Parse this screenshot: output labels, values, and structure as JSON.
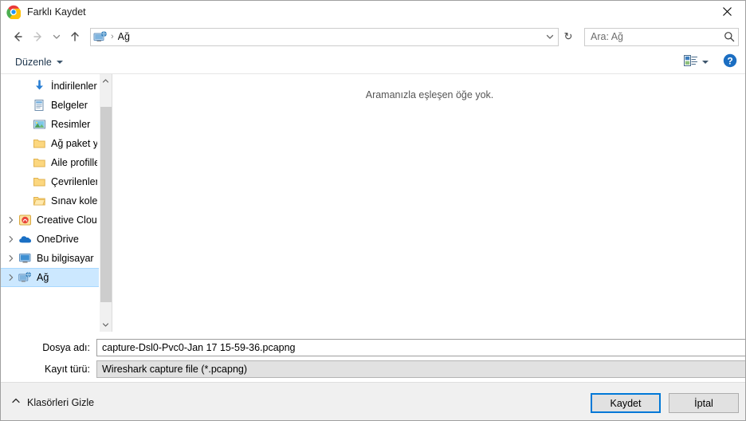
{
  "window": {
    "title": "Farklı Kaydet",
    "app_icon": "chrome-icon",
    "close_label": "×"
  },
  "nav": {
    "back_icon": "back-arrow-icon",
    "forward_icon": "forward-arrow-icon",
    "recent_icon": "chevron-down-icon",
    "up_icon": "up-arrow-icon",
    "address_icon": "network-icon",
    "breadcrumb": "Ağ",
    "breadcrumb_separator": "›",
    "dropdown_icon": "chevron-down-icon",
    "refresh_icon": "refresh-icon",
    "refresh_glyph": "↻"
  },
  "search": {
    "placeholder": "Ara: Ağ",
    "icon": "search-icon"
  },
  "toolbar": {
    "organize_label": "Düzenle",
    "organize_icon": "caret-down-icon",
    "view_icon": "view-layout-icon",
    "view_dropdown_icon": "caret-down-icon",
    "help_icon": "help-circle-icon"
  },
  "sidebar": {
    "items": [
      {
        "label": "İndirilenler",
        "icon": "downloads-icon",
        "pinned": true,
        "expander": false,
        "indent": true,
        "selected": false
      },
      {
        "label": "Belgeler",
        "icon": "documents-icon",
        "pinned": true,
        "expander": false,
        "indent": true,
        "selected": false
      },
      {
        "label": "Resimler",
        "icon": "pictures-icon",
        "pinned": true,
        "expander": false,
        "indent": true,
        "selected": false
      },
      {
        "label": "Ağ paket yakalar",
        "icon": "folder-icon",
        "pinned": false,
        "expander": false,
        "indent": true,
        "selected": false
      },
      {
        "label": "Aile profilleri (eb",
        "icon": "folder-icon",
        "pinned": false,
        "expander": false,
        "indent": true,
        "selected": false
      },
      {
        "label": "Çevrilenler",
        "icon": "folder-icon",
        "pinned": false,
        "expander": false,
        "indent": true,
        "selected": false
      },
      {
        "label": "Sınav koleji",
        "icon": "folder-open-icon",
        "pinned": false,
        "expander": false,
        "indent": true,
        "selected": false
      },
      {
        "label": "Creative Cloud Fil",
        "icon": "creative-cloud-icon",
        "pinned": false,
        "expander": true,
        "indent": false,
        "selected": false
      },
      {
        "label": "OneDrive",
        "icon": "onedrive-icon",
        "pinned": false,
        "expander": true,
        "indent": false,
        "selected": false
      },
      {
        "label": "Bu bilgisayar",
        "icon": "computer-icon",
        "pinned": false,
        "expander": true,
        "indent": false,
        "selected": false
      },
      {
        "label": "Ağ",
        "icon": "network-icon",
        "pinned": false,
        "expander": true,
        "indent": false,
        "selected": true
      }
    ],
    "scroll_up_icon": "chevron-up-icon",
    "scroll_down_icon": "chevron-down-icon"
  },
  "main": {
    "empty_message": "Aramanızla eşleşen öğe yok."
  },
  "form": {
    "filename_label": "Dosya adı:",
    "filename_value": "capture-Dsl0-Pvc0-Jan 17 15-59-36.pcapng",
    "filetype_label": "Kayıt türü:",
    "filetype_value": "Wireshark capture file (*.pcapng)",
    "dropdown_icon": "chevron-down-icon"
  },
  "footer": {
    "hide_folders_label": "Klasörleri Gizle",
    "hide_folders_icon": "chevron-up-icon",
    "save_label": "Kaydet",
    "cancel_label": "İptal"
  },
  "colors": {
    "selection": "#cce8ff",
    "focus_border": "#0078d7",
    "help_blue": "#1b6ec2",
    "footer_bg": "#f0f0f0"
  }
}
